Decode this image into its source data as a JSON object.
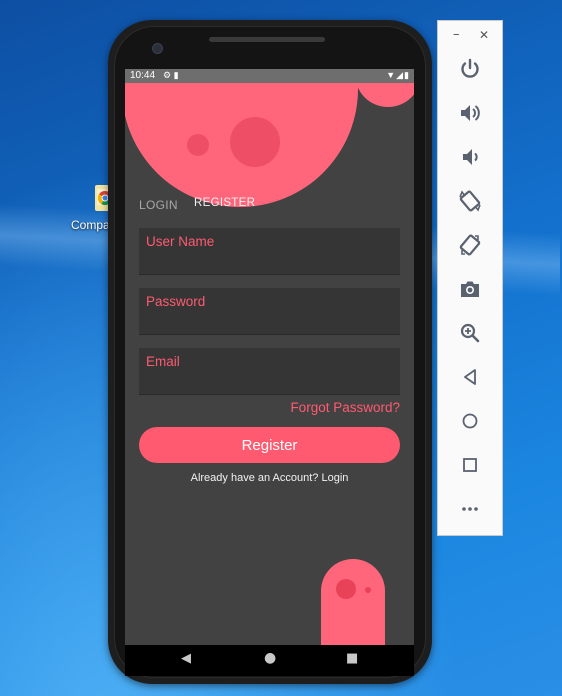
{
  "desktop": {
    "icon": {
      "label": "Compa",
      "icon": "app-shortcut-icon"
    }
  },
  "emulator": {
    "status_bar": {
      "time": "10:44",
      "left_icons": [
        "settings-notification-icon",
        "sd-card-icon"
      ],
      "right_icons": [
        "wifi-icon",
        "signal-icon",
        "battery-icon"
      ]
    },
    "app": {
      "tabs": [
        {
          "label": "LOGIN",
          "active": false
        },
        {
          "label": "REGISTER",
          "active": true
        }
      ],
      "fields": {
        "username": {
          "label": "User Name",
          "value": ""
        },
        "password": {
          "label": "Password",
          "value": ""
        },
        "email": {
          "label": "Email",
          "value": ""
        }
      },
      "forgot_password": "Forgot Password?",
      "register_button": "Register",
      "login_prompt": "Already have an Account? Login",
      "accent_color": "#ff5a70",
      "background_color": "#424242"
    },
    "nav_bar": {
      "buttons": [
        "back-icon",
        "home-icon",
        "recents-icon"
      ]
    },
    "side_panel": {
      "window_buttons": {
        "minimize": "–",
        "close": "✕"
      },
      "controls": [
        "power-icon",
        "volume-up-icon",
        "volume-down-icon",
        "rotate-left-icon",
        "rotate-right-icon",
        "camera-icon",
        "zoom-icon",
        "back-icon",
        "home-icon",
        "overview-icon",
        "more-icon"
      ]
    }
  }
}
